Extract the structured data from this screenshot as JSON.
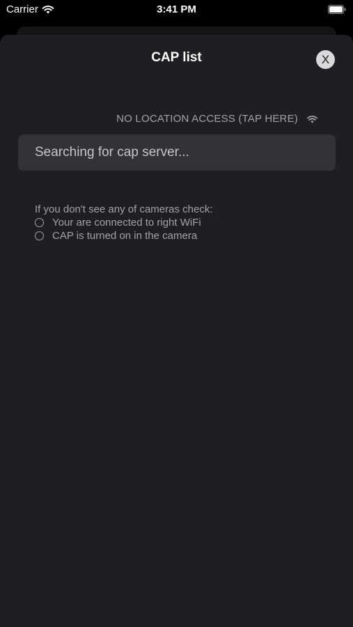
{
  "status_bar": {
    "carrier": "Carrier",
    "time": "3:41 PM",
    "icons": [
      "wifi-icon",
      "battery-icon"
    ]
  },
  "sheet": {
    "title": "CAP list",
    "close_label": "X",
    "location_access": "NO LOCATION ACCESS (TAP HERE)",
    "location_icon": "wifi-icon",
    "search_status": "Searching for cap server...",
    "help": {
      "title": "If you don't see any of cameras check:",
      "items": [
        "Your are connected to right WiFi",
        "CAP is turned on in the camera"
      ]
    }
  },
  "colors": {
    "sheet_bg": "#1f1f21",
    "search_bg": "#333335",
    "secondary_text": "#a3a3a6",
    "close_button_bg": "#d9d9d9"
  }
}
